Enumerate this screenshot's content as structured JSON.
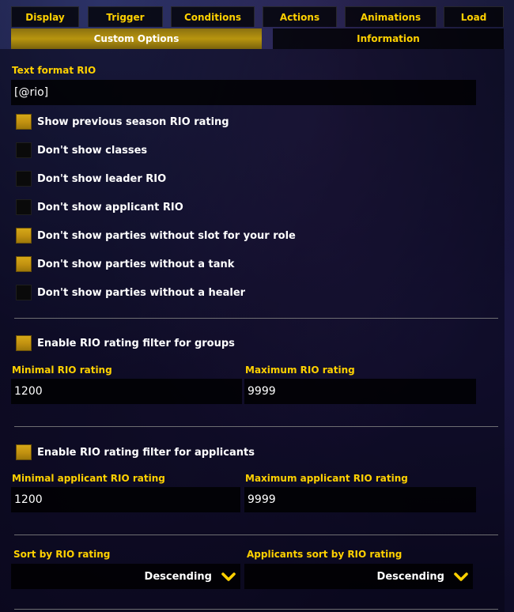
{
  "tabs": [
    "Display",
    "Trigger",
    "Conditions",
    "Actions",
    "Animations",
    "Load"
  ],
  "subtabs": {
    "active": "Custom Options",
    "inactive": "Information"
  },
  "text_format": {
    "label": "Text format RIO",
    "value": "[@rio]"
  },
  "checkboxes": [
    {
      "label": "Show previous season RIO rating",
      "checked": true
    },
    {
      "label": "Don't show classes",
      "checked": false
    },
    {
      "label": "Don't show leader RIO",
      "checked": false
    },
    {
      "label": "Don't show applicant RIO",
      "checked": false
    },
    {
      "label": "Don't show parties without slot for your role",
      "checked": true
    },
    {
      "label": "Don't show parties without a tank",
      "checked": true
    },
    {
      "label": "Don't show parties without a healer",
      "checked": false
    }
  ],
  "group_filter": {
    "checkbox": {
      "label": "Enable RIO rating filter for groups",
      "checked": true
    },
    "min_label": "Minimal RIO rating",
    "min_value": "1200",
    "max_label": "Maximum RIO rating",
    "max_value": "9999"
  },
  "applicant_filter": {
    "checkbox": {
      "label": "Enable RIO rating filter for applicants",
      "checked": true
    },
    "min_label": "Minimal applicant RIO rating",
    "min_value": "1200",
    "max_label": "Maximum applicant RIO rating",
    "max_value": "9999"
  },
  "sort": {
    "rio_label": "Sort by RIO rating",
    "rio_value": "Descending",
    "applicants_label": "Applicants sort by RIO rating",
    "applicants_value": "Descending"
  },
  "colors": {
    "accent": "#ffd100",
    "checkbox_checked": "#c09010",
    "subtab_active": "#b8950f"
  },
  "icons": {
    "dropdown": "chevron-down-icon"
  }
}
